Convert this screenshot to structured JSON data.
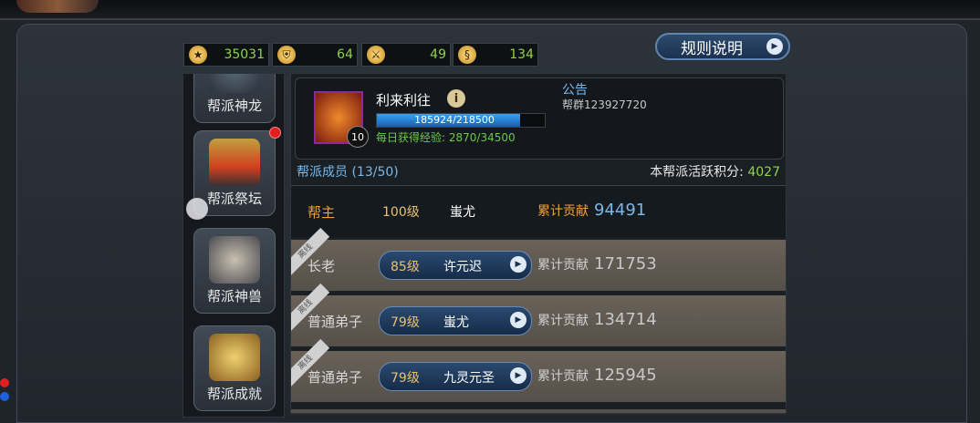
{
  "resources": [
    {
      "icon": "coin-icon",
      "glyph": "★",
      "value": "35031"
    },
    {
      "icon": "helmet-icon",
      "glyph": "⛨",
      "value": "64"
    },
    {
      "icon": "crossed-swords-icon",
      "glyph": "⚔",
      "value": "49"
    },
    {
      "icon": "scroll-icon",
      "glyph": "§",
      "value": "134"
    }
  ],
  "rules_button": {
    "label": "规则说明",
    "icon": "play-arrow-icon"
  },
  "sidebar": {
    "items": [
      {
        "label": "帮派神龙",
        "icon": "dragon-icon"
      },
      {
        "label": "帮派祭坛",
        "icon": "altar-icon",
        "badge": true
      },
      {
        "label": "帮派神兽",
        "icon": "beast-icon"
      },
      {
        "label": "帮派成就",
        "icon": "achievement-icon"
      }
    ]
  },
  "guild": {
    "name": "利来利往",
    "level": "10",
    "exp_text": "185924/218500",
    "exp_fraction": 0.851,
    "daily_exp": "每日获得经验: 2870/34500",
    "notice_title": "公告",
    "notice_content": "帮群123927720"
  },
  "members_header": {
    "count_label": "帮派成员 (13/50)",
    "activity_label": "本帮派活跃积分:",
    "activity_value": "4027"
  },
  "leader": {
    "rank": "帮主",
    "level": "100级",
    "name": "蚩尤",
    "contrib_label": "累计贡献",
    "contrib_value": "94491"
  },
  "members": [
    {
      "ribbon": "离线",
      "rank": "长老",
      "level": "85级",
      "name": "许元迟",
      "contrib_label": "累计贡献",
      "contrib_value": "171753"
    },
    {
      "ribbon": "离线",
      "rank": "普通弟子",
      "level": "79级",
      "name": "蚩尤",
      "contrib_label": "累计贡献",
      "contrib_value": "134714"
    },
    {
      "ribbon": "离线",
      "rank": "普通弟子",
      "level": "79级",
      "name": "九灵元圣",
      "contrib_label": "累计贡献",
      "contrib_value": "125945"
    }
  ],
  "colors": {
    "accent_green": "#8ed24a",
    "accent_blue": "#7ab8e8",
    "leader_orange": "#f0a03a"
  }
}
